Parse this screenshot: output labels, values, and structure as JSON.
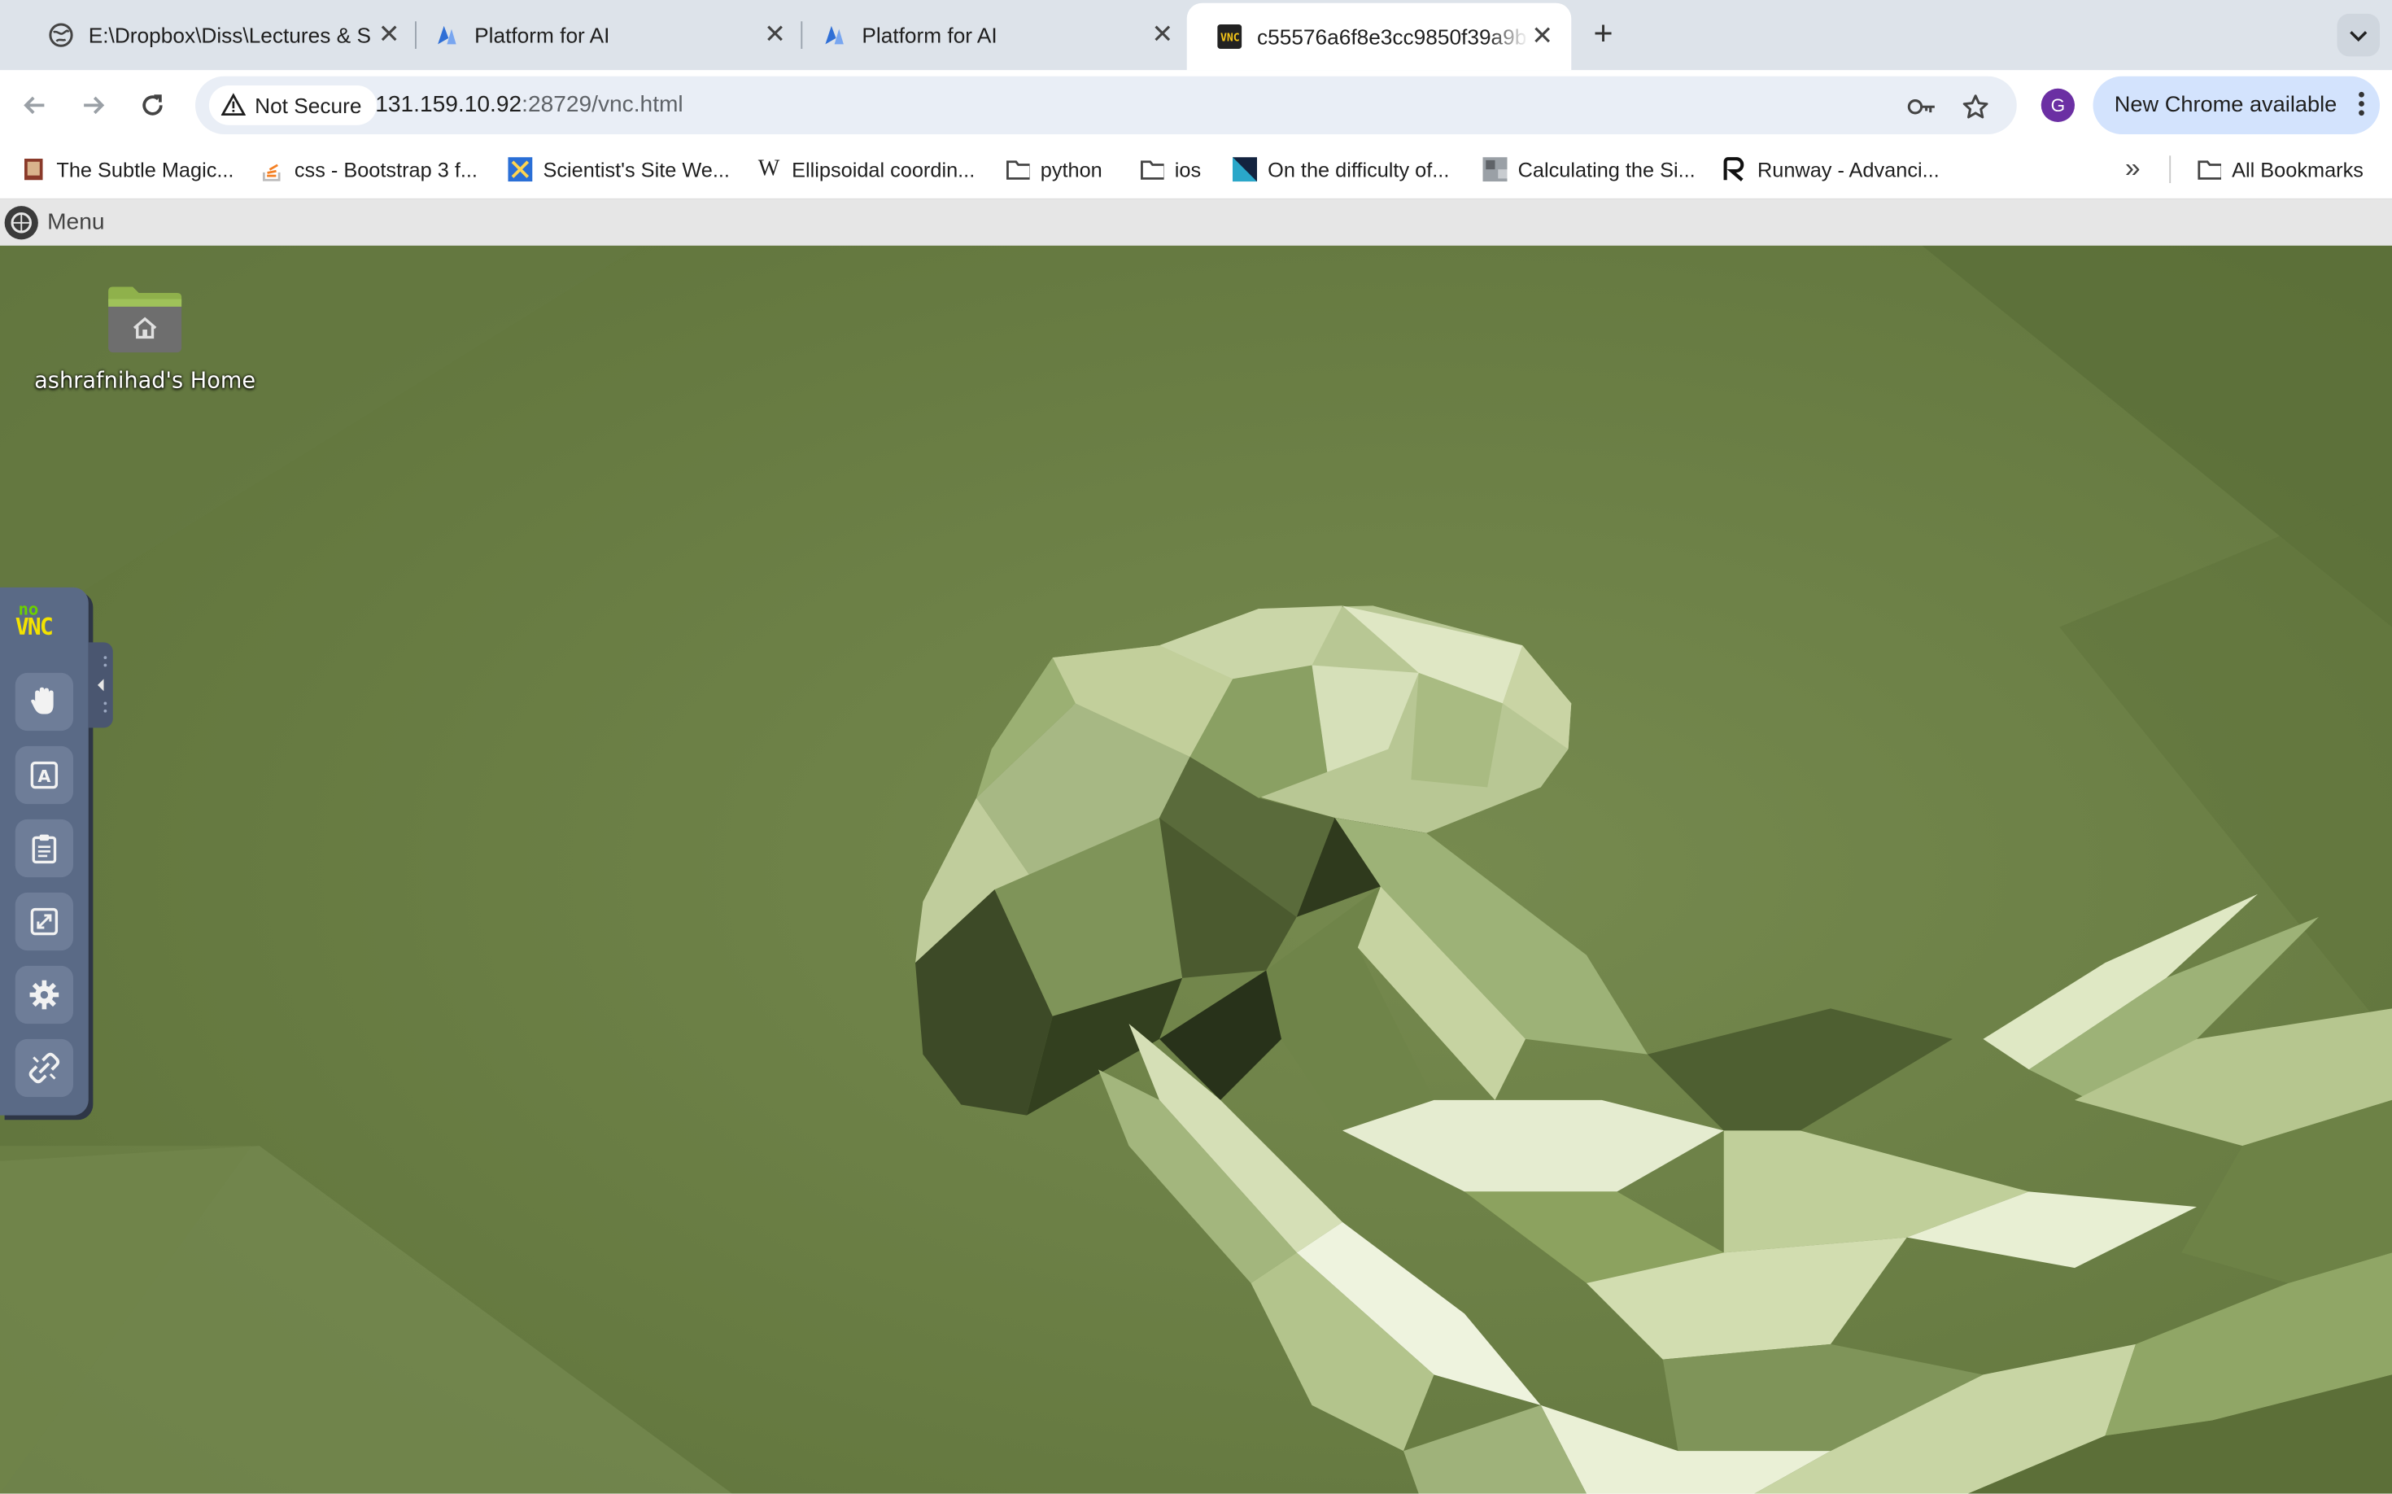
{
  "tabs": [
    {
      "title": "E:\\Dropbox\\Diss\\Lectures & S",
      "favicon": "globe-icon",
      "active": false
    },
    {
      "title": "Platform for AI",
      "favicon": "platform-ai-icon",
      "active": false
    },
    {
      "title": "Platform for AI",
      "favicon": "platform-ai-icon",
      "active": false
    },
    {
      "title": "c55576a6f8e3cc9850f39a9b",
      "favicon": "vnc-icon",
      "active": true
    }
  ],
  "toolbar": {
    "security_label": "Not Secure",
    "url_host": "131.159.10.92",
    "url_rest": ":28729/vnc.html",
    "profile_initial": "G",
    "update_label": "New Chrome available"
  },
  "bookmarks": [
    {
      "label": "The Subtle Magic...",
      "icon": "book-icon"
    },
    {
      "label": "css - Bootstrap 3 f...",
      "icon": "stackoverflow-icon"
    },
    {
      "label": "Scientist's Site We...",
      "icon": "scientist-site-icon"
    },
    {
      "label": "Ellipsoidal coordin...",
      "icon": "wikipedia-icon"
    },
    {
      "label": "python",
      "icon": "folder-icon"
    },
    {
      "label": "ios",
      "icon": "folder-icon"
    },
    {
      "label": "On the difficulty of...",
      "icon": "paper-icon"
    },
    {
      "label": "Calculating the Si...",
      "icon": "image-thumb-icon"
    },
    {
      "label": "Runway - Advanci...",
      "icon": "runway-icon"
    }
  ],
  "all_bookmarks_label": "All Bookmarks",
  "vnc": {
    "menu_label": "Menu",
    "home_label": "ashrafnihad's Home",
    "novnc_logo": [
      "no",
      "VNC"
    ],
    "controls": [
      "drag-hand-icon",
      "keyboard-icon",
      "clipboard-icon",
      "fullscreen-icon",
      "settings-icon",
      "disconnect-icon"
    ]
  },
  "colors": {
    "tabstrip": "#dde3ea",
    "omnibox": "#e9eef6",
    "update_pill": "#d3e3fd",
    "desktop_green": "#6a7f45",
    "novnc_bar": "#5a6a86"
  }
}
